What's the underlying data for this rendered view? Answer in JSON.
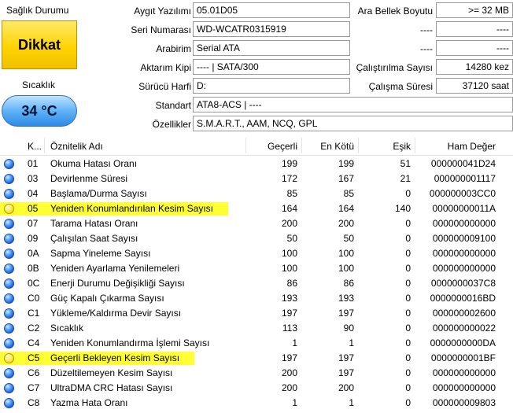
{
  "health": {
    "label": "Sağlık Durumu",
    "status": "Dikkat",
    "status_color": "#ffd400"
  },
  "temperature": {
    "label": "Sıcaklık",
    "value": "34 °C",
    "color": "#2d8ae6"
  },
  "info": {
    "firmware": {
      "label": "Aygıt Yazılımı",
      "value": "05.01D05"
    },
    "serial": {
      "label": "Seri Numarası",
      "value": "WD-WCATR0315919"
    },
    "interface": {
      "label": "Arabirim",
      "value": "Serial ATA"
    },
    "transfer": {
      "label": "Aktarım Kipi",
      "value": "---- | SATA/300"
    },
    "drive_letter": {
      "label": "Sürücü Harfi",
      "value": "D:"
    },
    "standard": {
      "label": "Standart",
      "value": "ATA8-ACS | ----"
    },
    "features": {
      "label": "Özellikler",
      "value": "S.M.A.R.T., AAM, NCQ, GPL"
    },
    "buffer": {
      "label": "Ara Bellek Boyutu",
      "value": ">= 32 MB"
    },
    "r2_label": "----",
    "r2_value": "----",
    "r3_label": "----",
    "r3_value": "----",
    "power_on_count": {
      "label": "Çalıştırılma Sayısı",
      "value": "14280 kez"
    },
    "power_on_hours": {
      "label": "Çalışma Süresi",
      "value": "37120 saat"
    }
  },
  "table": {
    "headers": {
      "id": "K...",
      "name": "Öznitelik Adı",
      "current": "Geçerli",
      "worst": "En Kötü",
      "threshold": "Eşik",
      "raw": "Ham Değer"
    },
    "highlight_color": "#ffff33",
    "rows": [
      {
        "status": "good",
        "id": "01",
        "name": "Okuma Hatası Oranı",
        "current": "199",
        "worst": "199",
        "threshold": "51",
        "raw": "000000041D24"
      },
      {
        "status": "good",
        "id": "03",
        "name": "Devirlenme Süresi",
        "current": "172",
        "worst": "167",
        "threshold": "21",
        "raw": "000000001117"
      },
      {
        "status": "good",
        "id": "04",
        "name": "Başlama/Durma Sayısı",
        "current": "85",
        "worst": "85",
        "threshold": "0",
        "raw": "000000003CC0"
      },
      {
        "status": "caution",
        "highlight": true,
        "id": "05",
        "name": "Yeniden Konumlandırılan Kesim Sayısı",
        "current": "164",
        "worst": "164",
        "threshold": "140",
        "raw": "00000000011A"
      },
      {
        "status": "good",
        "id": "07",
        "name": "Tarama Hatası Oranı",
        "current": "200",
        "worst": "200",
        "threshold": "0",
        "raw": "000000000000"
      },
      {
        "status": "good",
        "id": "09",
        "name": "Çalışılan Saat Sayısı",
        "current": "50",
        "worst": "50",
        "threshold": "0",
        "raw": "000000009100"
      },
      {
        "status": "good",
        "id": "0A",
        "name": "Sapma Yineleme Sayısı",
        "current": "100",
        "worst": "100",
        "threshold": "0",
        "raw": "000000000000"
      },
      {
        "status": "good",
        "id": "0B",
        "name": "Yeniden Ayarlama Yenilemeleri",
        "current": "100",
        "worst": "100",
        "threshold": "0",
        "raw": "000000000000"
      },
      {
        "status": "good",
        "id": "0C",
        "name": "Enerji Durumu Değişikliği Sayısı",
        "current": "86",
        "worst": "86",
        "threshold": "0",
        "raw": "0000000037C8"
      },
      {
        "status": "good",
        "id": "C0",
        "name": "Güç Kapalı Çıkarma Sayısı",
        "current": "193",
        "worst": "193",
        "threshold": "0",
        "raw": "0000000016BD"
      },
      {
        "status": "good",
        "id": "C1",
        "name": "Yükleme/Kaldırma Devir Sayısı",
        "current": "197",
        "worst": "197",
        "threshold": "0",
        "raw": "000000002600"
      },
      {
        "status": "good",
        "id": "C2",
        "name": "Sıcaklık",
        "current": "113",
        "worst": "90",
        "threshold": "0",
        "raw": "000000000022"
      },
      {
        "status": "good",
        "id": "C4",
        "name": "Yeniden Konumlandırma İşlemi Sayısı",
        "current": "1",
        "worst": "1",
        "threshold": "0",
        "raw": "0000000000DA"
      },
      {
        "status": "caution",
        "highlight": true,
        "id": "C5",
        "name": "Geçerli Bekleyen Kesim Sayısı",
        "current": "197",
        "worst": "197",
        "threshold": "0",
        "raw": "0000000001BF"
      },
      {
        "status": "good",
        "id": "C6",
        "name": "Düzeltilemeyen Kesim Sayısı",
        "current": "200",
        "worst": "197",
        "threshold": "0",
        "raw": "000000000000"
      },
      {
        "status": "good",
        "id": "C7",
        "name": "UltraDMA CRC Hatası Sayısı",
        "current": "200",
        "worst": "200",
        "threshold": "0",
        "raw": "000000000000"
      },
      {
        "status": "good",
        "id": "C8",
        "name": "Yazma Hata Oranı",
        "current": "1",
        "worst": "1",
        "threshold": "0",
        "raw": "000000009803"
      }
    ]
  }
}
